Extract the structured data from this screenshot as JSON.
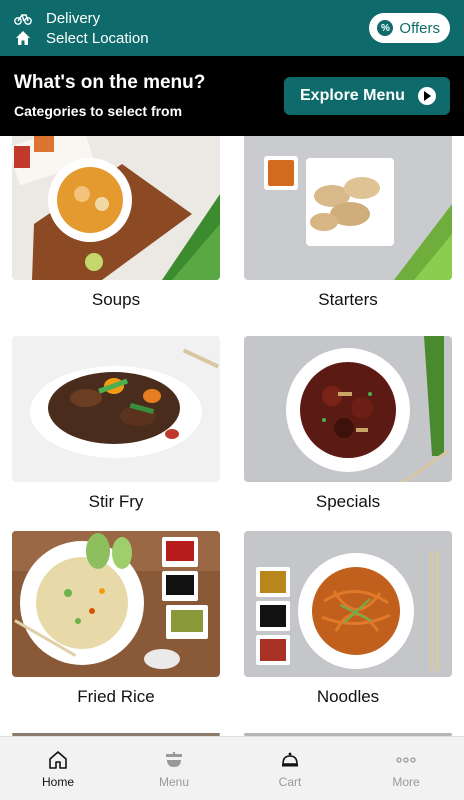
{
  "header": {
    "delivery_label": "Delivery",
    "location_label": "Select Location",
    "offers_label": "Offers"
  },
  "banner": {
    "title": "What's on the menu?",
    "subtitle": "Categories to select from",
    "explore_label": "Explore Menu"
  },
  "categories": [
    {
      "label": "Soups"
    },
    {
      "label": "Starters"
    },
    {
      "label": "Stir Fry"
    },
    {
      "label": "Specials"
    },
    {
      "label": "Fried Rice"
    },
    {
      "label": "Noodles"
    }
  ],
  "nav": {
    "items": [
      {
        "label": "Home",
        "icon": "home-icon"
      },
      {
        "label": "Menu",
        "icon": "menu-icon"
      },
      {
        "label": "Cart",
        "icon": "cart-icon"
      },
      {
        "label": "More",
        "icon": "more-icon"
      }
    ]
  },
  "colors": {
    "primary": "#0f6b6b",
    "banner_bg": "#000000"
  }
}
